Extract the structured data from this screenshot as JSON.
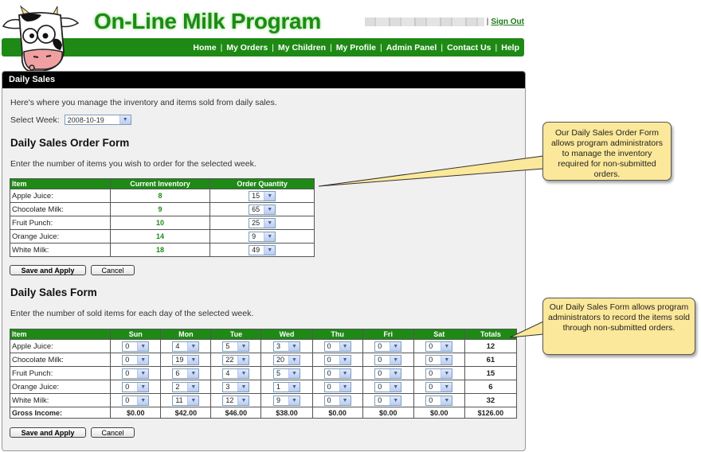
{
  "header": {
    "site_title": "On-Line Milk Program",
    "sign_out": "Sign Out",
    "user_sep": "|",
    "nav": [
      {
        "label": "Home"
      },
      {
        "label": "My Orders"
      },
      {
        "label": "My Children"
      },
      {
        "label": "My Profile"
      },
      {
        "label": "Admin Panel"
      },
      {
        "label": "Contact Us"
      },
      {
        "label": "Help"
      }
    ],
    "nav_sep": "|",
    "logo_icon": "cow-mascot-icon"
  },
  "panel": {
    "title": "Daily Sales",
    "intro": "Here's where you manage the inventory and items sold from daily sales.",
    "week_label": "Select Week:",
    "week_value": "2008-10-19"
  },
  "order_form": {
    "heading": "Daily Sales Order Form",
    "description": "Enter the number of items you wish to order for the selected week.",
    "columns": [
      "Item",
      "Current Inventory",
      "Order Quantity"
    ],
    "rows": [
      {
        "item": "Apple Juice:",
        "inventory": "8",
        "order": "15"
      },
      {
        "item": "Chocolate Milk:",
        "inventory": "9",
        "order": "65"
      },
      {
        "item": "Fruit Punch:",
        "inventory": "10",
        "order": "25"
      },
      {
        "item": "Orange Juice:",
        "inventory": "14",
        "order": "9"
      },
      {
        "item": "White Milk:",
        "inventory": "18",
        "order": "49"
      }
    ],
    "save_label": "Save and Apply",
    "cancel_label": "Cancel"
  },
  "sales_form": {
    "heading": "Daily Sales Form",
    "description": "Enter the number of sold items for each day of the selected week.",
    "columns": [
      "Item",
      "Sun",
      "Mon",
      "Tue",
      "Wed",
      "Thu",
      "Fri",
      "Sat",
      "Totals"
    ],
    "rows": [
      {
        "item": "Apple Juice:",
        "days": [
          "0",
          "4",
          "5",
          "3",
          "0",
          "0",
          "0"
        ],
        "total": "12"
      },
      {
        "item": "Chocolate Milk:",
        "days": [
          "0",
          "19",
          "22",
          "20",
          "0",
          "0",
          "0"
        ],
        "total": "61"
      },
      {
        "item": "Fruit Punch:",
        "days": [
          "0",
          "6",
          "4",
          "5",
          "0",
          "0",
          "0"
        ],
        "total": "15"
      },
      {
        "item": "Orange Juice:",
        "days": [
          "0",
          "2",
          "3",
          "1",
          "0",
          "0",
          "0"
        ],
        "total": "6"
      },
      {
        "item": "White Milk:",
        "days": [
          "0",
          "11",
          "12",
          "9",
          "0",
          "0",
          "0"
        ],
        "total": "32"
      }
    ],
    "gross": {
      "label": "Gross Income:",
      "days": [
        "$0.00",
        "$42.00",
        "$46.00",
        "$38.00",
        "$0.00",
        "$0.00",
        "$0.00"
      ],
      "total": "$126.00"
    },
    "save_label": "Save and Apply",
    "cancel_label": "Cancel"
  },
  "callouts": {
    "order_form": "Our Daily Sales Order Form allows program administrators to manage the inventory required for non-submitted orders.",
    "sales_form": "Our Daily Sales Form allows program administrators to record the items sold through non-submitted orders."
  },
  "colors": {
    "brand_green": "#1e8a15",
    "callout_yellow": "#fce89a",
    "panel_header": "#000000"
  }
}
